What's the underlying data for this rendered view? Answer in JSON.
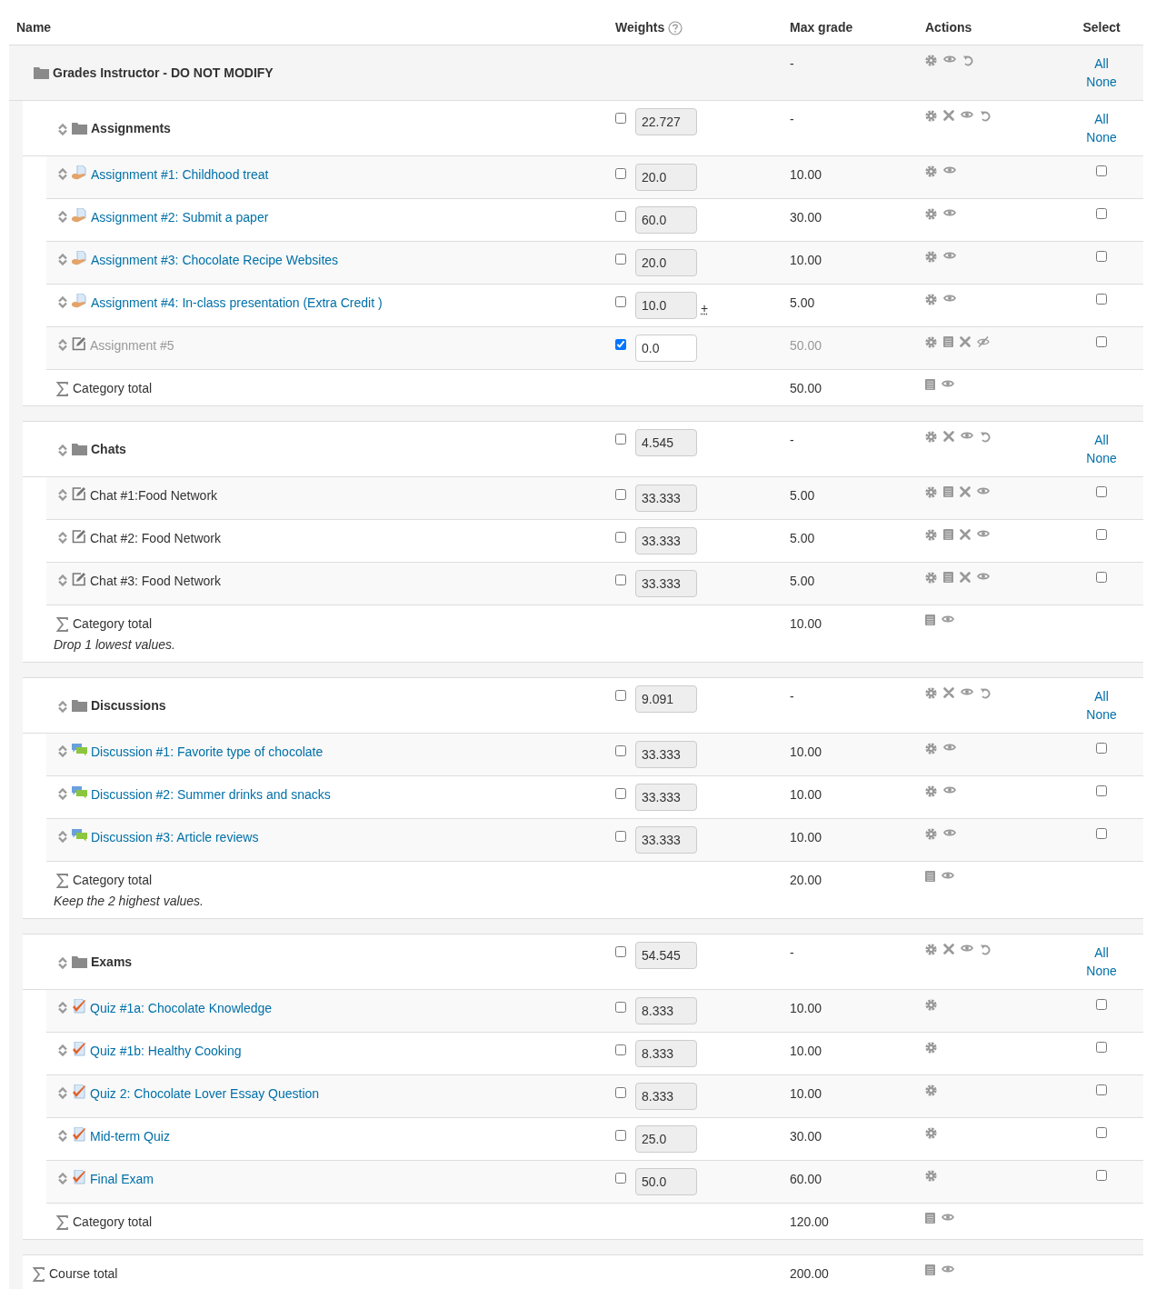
{
  "columns": [
    "Name",
    "Weights",
    "Max grade",
    "Actions",
    "Select"
  ],
  "course": {
    "name": "Grades Instructor - DO NOT MODIFY",
    "max_grade": "-",
    "actions": [
      {
        "kind": "settings"
      },
      {
        "kind": "show"
      },
      {
        "kind": "reset"
      }
    ],
    "select_all": "All",
    "select_none": "None",
    "categories": [
      {
        "name": "Assignments",
        "weight_override": false,
        "weight": "22.727",
        "max_grade": "-",
        "actions": [
          {
            "kind": "settings"
          },
          {
            "kind": "delete"
          },
          {
            "kind": "show"
          },
          {
            "kind": "reset"
          }
        ],
        "select_all": "All",
        "select_none": "None",
        "items": [
          {
            "kind": "assign",
            "name": "Assignment #1: Childhood treat",
            "hidden": false,
            "weight_override": false,
            "weight": "20.0",
            "max_grade": "10.00",
            "actions": [
              {
                "kind": "settings"
              },
              {
                "kind": "show"
              }
            ],
            "selected": false
          },
          {
            "kind": "assign",
            "name": "Assignment #2: Submit a paper",
            "hidden": false,
            "weight_override": false,
            "weight": "60.0",
            "max_grade": "30.00",
            "actions": [
              {
                "kind": "settings"
              },
              {
                "kind": "show"
              }
            ],
            "selected": false
          },
          {
            "kind": "assign",
            "name": "Assignment #3: Chocolate Recipe Websites",
            "hidden": false,
            "weight_override": false,
            "weight": "20.0",
            "max_grade": "10.00",
            "actions": [
              {
                "kind": "settings"
              },
              {
                "kind": "show"
              }
            ],
            "selected": false
          },
          {
            "kind": "assign",
            "name": "Assignment #4: In-class presentation (Extra Credit )",
            "hidden": false,
            "weight_override": false,
            "weight": "10.0",
            "weight_note": "+",
            "max_grade": "5.00",
            "actions": [
              {
                "kind": "settings"
              },
              {
                "kind": "show"
              }
            ],
            "selected": false
          },
          {
            "kind": "manual",
            "name": "Assignment #5",
            "hidden": true,
            "weight_override": true,
            "weight": "0.0",
            "max_grade": "50.00",
            "actions": [
              {
                "kind": "settings"
              },
              {
                "kind": "calc"
              },
              {
                "kind": "delete"
              },
              {
                "kind": "hide"
              }
            ],
            "selected": false
          }
        ],
        "total": {
          "label": "Category total",
          "max_grade": "50.00",
          "actions": [
            {
              "kind": "calc"
            },
            {
              "kind": "show"
            }
          ]
        }
      },
      {
        "name": "Chats",
        "weight_override": false,
        "weight": "4.545",
        "max_grade": "-",
        "actions": [
          {
            "kind": "settings"
          },
          {
            "kind": "delete"
          },
          {
            "kind": "show"
          },
          {
            "kind": "reset"
          }
        ],
        "select_all": "All",
        "select_none": "None",
        "items": [
          {
            "kind": "manual",
            "name": "Chat #1:Food Network",
            "hidden": false,
            "weight_override": false,
            "weight": "33.333",
            "max_grade": "5.00",
            "actions": [
              {
                "kind": "settings"
              },
              {
                "kind": "calc"
              },
              {
                "kind": "delete"
              },
              {
                "kind": "show"
              }
            ],
            "selected": false
          },
          {
            "kind": "manual",
            "name": "Chat #2: Food Network",
            "hidden": false,
            "weight_override": false,
            "weight": "33.333",
            "max_grade": "5.00",
            "actions": [
              {
                "kind": "settings"
              },
              {
                "kind": "calc"
              },
              {
                "kind": "delete"
              },
              {
                "kind": "show"
              }
            ],
            "selected": false
          },
          {
            "kind": "manual",
            "name": "Chat #3: Food Network",
            "hidden": false,
            "weight_override": false,
            "weight": "33.333",
            "max_grade": "5.00",
            "actions": [
              {
                "kind": "settings"
              },
              {
                "kind": "calc"
              },
              {
                "kind": "delete"
              },
              {
                "kind": "show"
              }
            ],
            "selected": false
          }
        ],
        "total": {
          "label": "Category total",
          "note": "Drop 1 lowest values.",
          "max_grade": "10.00",
          "actions": [
            {
              "kind": "calc"
            },
            {
              "kind": "show"
            }
          ]
        }
      },
      {
        "name": "Discussions",
        "weight_override": false,
        "weight": "9.091",
        "max_grade": "-",
        "actions": [
          {
            "kind": "settings"
          },
          {
            "kind": "delete"
          },
          {
            "kind": "show"
          },
          {
            "kind": "reset"
          }
        ],
        "select_all": "All",
        "select_none": "None",
        "items": [
          {
            "kind": "forum",
            "name": "Discussion #1: Favorite type of chocolate",
            "hidden": false,
            "weight_override": false,
            "weight": "33.333",
            "max_grade": "10.00",
            "actions": [
              {
                "kind": "settings"
              },
              {
                "kind": "show"
              }
            ],
            "selected": false
          },
          {
            "kind": "forum",
            "name": "Discussion #2: Summer drinks and snacks",
            "hidden": false,
            "weight_override": false,
            "weight": "33.333",
            "max_grade": "10.00",
            "actions": [
              {
                "kind": "settings"
              },
              {
                "kind": "show"
              }
            ],
            "selected": false
          },
          {
            "kind": "forum",
            "name": "Discussion #3: Article reviews",
            "hidden": false,
            "weight_override": false,
            "weight": "33.333",
            "max_grade": "10.00",
            "actions": [
              {
                "kind": "settings"
              },
              {
                "kind": "show"
              }
            ],
            "selected": false
          }
        ],
        "total": {
          "label": "Category total",
          "note": "Keep the 2 highest values.",
          "max_grade": "20.00",
          "actions": [
            {
              "kind": "calc"
            },
            {
              "kind": "show"
            }
          ]
        }
      },
      {
        "name": "Exams",
        "weight_override": false,
        "weight": "54.545",
        "max_grade": "-",
        "actions": [
          {
            "kind": "settings"
          },
          {
            "kind": "delete"
          },
          {
            "kind": "show"
          },
          {
            "kind": "reset"
          }
        ],
        "select_all": "All",
        "select_none": "None",
        "items": [
          {
            "kind": "quiz",
            "name": "Quiz #1a: Chocolate Knowledge",
            "hidden": false,
            "weight_override": false,
            "weight": "8.333",
            "max_grade": "10.00",
            "actions": [
              {
                "kind": "settings"
              }
            ],
            "selected": false
          },
          {
            "kind": "quiz",
            "name": "Quiz #1b: Healthy Cooking",
            "hidden": false,
            "weight_override": false,
            "weight": "8.333",
            "max_grade": "10.00",
            "actions": [
              {
                "kind": "settings"
              }
            ],
            "selected": false
          },
          {
            "kind": "quiz",
            "name": "Quiz 2: Chocolate Lover Essay Question",
            "hidden": false,
            "weight_override": false,
            "weight": "8.333",
            "max_grade": "10.00",
            "actions": [
              {
                "kind": "settings"
              }
            ],
            "selected": false
          },
          {
            "kind": "quiz",
            "name": "Mid-term Quiz",
            "hidden": false,
            "weight_override": false,
            "weight": "25.0",
            "max_grade": "30.00",
            "actions": [
              {
                "kind": "settings"
              }
            ],
            "selected": false
          },
          {
            "kind": "quiz",
            "name": "Final Exam",
            "hidden": false,
            "weight_override": false,
            "weight": "50.0",
            "max_grade": "60.00",
            "actions": [
              {
                "kind": "settings"
              }
            ],
            "selected": false
          }
        ],
        "total": {
          "label": "Category total",
          "max_grade": "120.00",
          "actions": [
            {
              "kind": "calc"
            },
            {
              "kind": "show"
            }
          ]
        }
      }
    ],
    "total": {
      "label": "Course total",
      "max_grade": "200.00",
      "actions": [
        {
          "kind": "calc"
        },
        {
          "kind": "show"
        }
      ]
    }
  }
}
